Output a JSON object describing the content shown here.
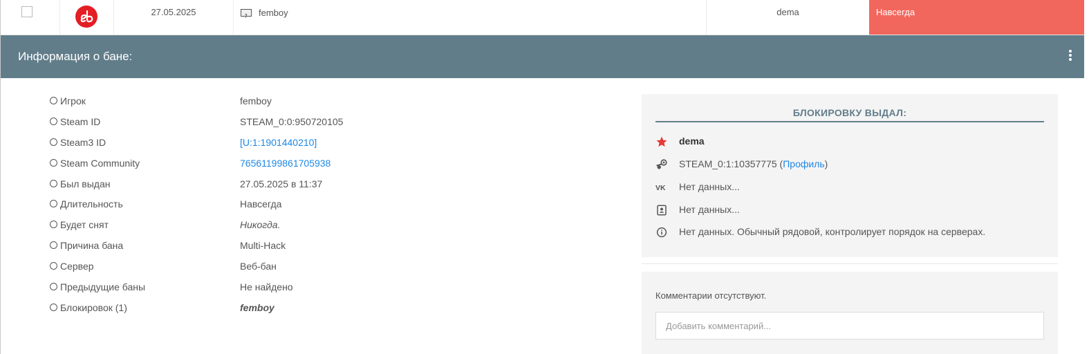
{
  "row": {
    "date": "27.05.2025",
    "player": "femboy",
    "admin": "dema",
    "length": "Навсегда"
  },
  "header": {
    "title": "Информация о бане:"
  },
  "info": [
    {
      "label": "Игрок",
      "value": "femboy"
    },
    {
      "label": "Steam ID",
      "value": "STEAM_0:0:950720105"
    },
    {
      "label": "Steam3 ID",
      "value": "[U:1:1901440210]"
    },
    {
      "label": "Steam Community",
      "value": "76561199861705938"
    },
    {
      "label": "Был выдан",
      "value": "27.05.2025 в 11:37"
    },
    {
      "label": "Длительность",
      "value": "Навсегда"
    },
    {
      "label": "Будет снят",
      "value": "Никогда."
    },
    {
      "label": "Причина бана",
      "value": "Multi-Hack"
    },
    {
      "label": "Сервер",
      "value": "Веб-бан"
    },
    {
      "label": "Предыдущие баны",
      "value": "Не найдено"
    },
    {
      "label": "Блокировок (1)",
      "value": "femboy"
    }
  ],
  "admin_panel": {
    "title": "БЛОКИРОВКУ ВЫДАЛ:",
    "name": "dema",
    "steam_id": "STEAM_0:1:10357775",
    "open_paren": "(",
    "profile_link": "Профиль",
    "close_paren": ")",
    "vk": "Нет данных...",
    "contact": "Нет данных...",
    "about": "Нет данных. Обычный рядовой, контролирует порядок на серверах."
  },
  "comments": {
    "none_text": "Комментарии отсутствуют.",
    "placeholder": "Добавить комментарий..."
  },
  "colors": {
    "header_bar": "#617d8a",
    "length_badge": "#f2675d",
    "link": "#1e88e5",
    "star": "#e53935"
  },
  "icons": [
    "sourcebans-logo-icon",
    "unknown-flag-icon",
    "more-vertical-icon",
    "star-icon",
    "steam-icon",
    "vk-icon",
    "contact-card-icon",
    "info-icon"
  ]
}
